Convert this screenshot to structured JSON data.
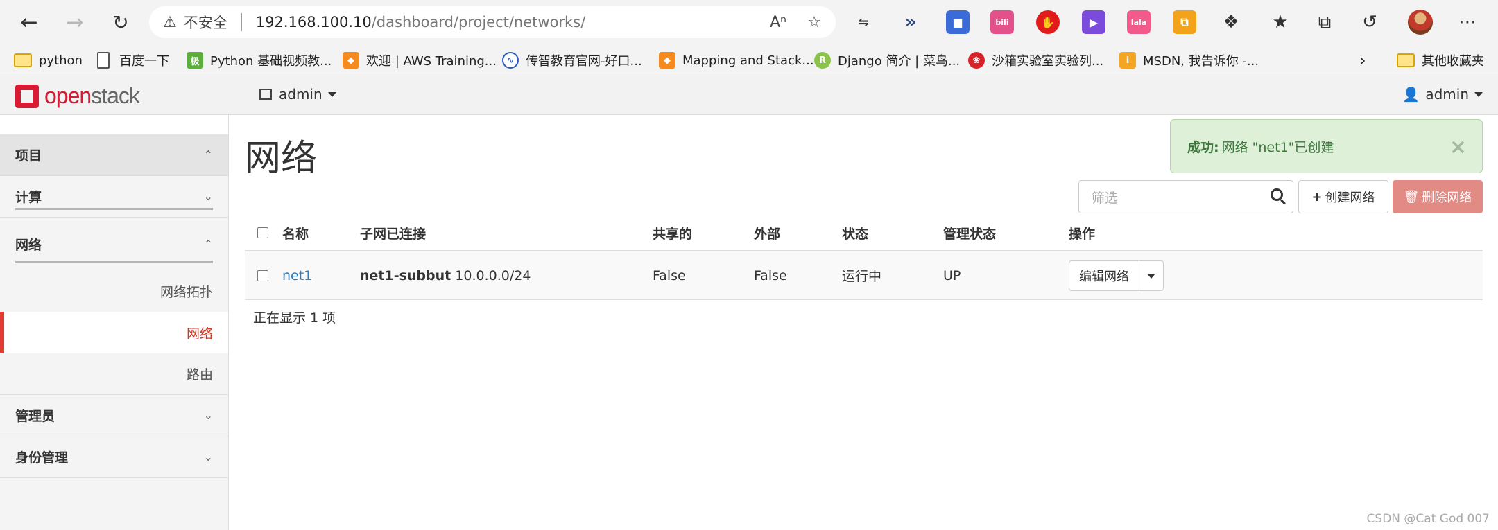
{
  "browser": {
    "address_insecure_label": "不安全",
    "url_host": "192.168.100.10",
    "url_path": "/dashboard/project/networks/",
    "bookmarks": [
      {
        "label": "python",
        "icon": "folder-icon"
      },
      {
        "label": "百度一下",
        "icon": "page-icon"
      },
      {
        "label": "Python 基础视频教...",
        "icon": "python-video-icon"
      },
      {
        "label": "欢迎 | AWS Training...",
        "icon": "aws-icon"
      },
      {
        "label": "传智教育官网-好口...",
        "icon": "itcast-icon"
      },
      {
        "label": "Mapping and Stack...",
        "icon": "aws-icon"
      },
      {
        "label": "Django 简介 | 菜鸟...",
        "icon": "runoob-icon"
      },
      {
        "label": "沙箱实验室实验列...",
        "icon": "huawei-icon"
      },
      {
        "label": "MSDN, 我告诉你 -...",
        "icon": "msdn-icon"
      }
    ],
    "other_bookmarks_label": "其他收藏夹"
  },
  "app": {
    "logo_open": "open",
    "logo_stack": "stack",
    "project_selector": "admin",
    "user_menu": "admin"
  },
  "sidebar": {
    "project": "项目",
    "compute": "计算",
    "network": "网络",
    "network_items": [
      "网络拓扑",
      "网络",
      "路由"
    ],
    "admin": "管理员",
    "identity": "身份管理"
  },
  "page": {
    "title": "网络",
    "alert_strong": "成功:",
    "alert_text": "网络 \"net1\"已创建",
    "filter_placeholder": "筛选",
    "create_button": "创建网络",
    "delete_button": "删除网络"
  },
  "table": {
    "columns": [
      "名称",
      "子网已连接",
      "共享的",
      "外部",
      "状态",
      "管理状态",
      "操作"
    ],
    "rows": [
      {
        "name": "net1",
        "subnet_name": "net1-subbut",
        "subnet_cidr": "10.0.0.0/24",
        "shared": "False",
        "external": "False",
        "status": "运行中",
        "admin_state": "UP",
        "action": "编辑网络"
      }
    ],
    "footer": "正在显示 1 项"
  },
  "watermark": "CSDN @Cat God 007",
  "colors": {
    "brand_red": "#da1a32",
    "active_red": "#e03c31",
    "success_bg": "#dff0d8",
    "link_blue": "#337ab7",
    "danger_btn": "#e28b85"
  }
}
